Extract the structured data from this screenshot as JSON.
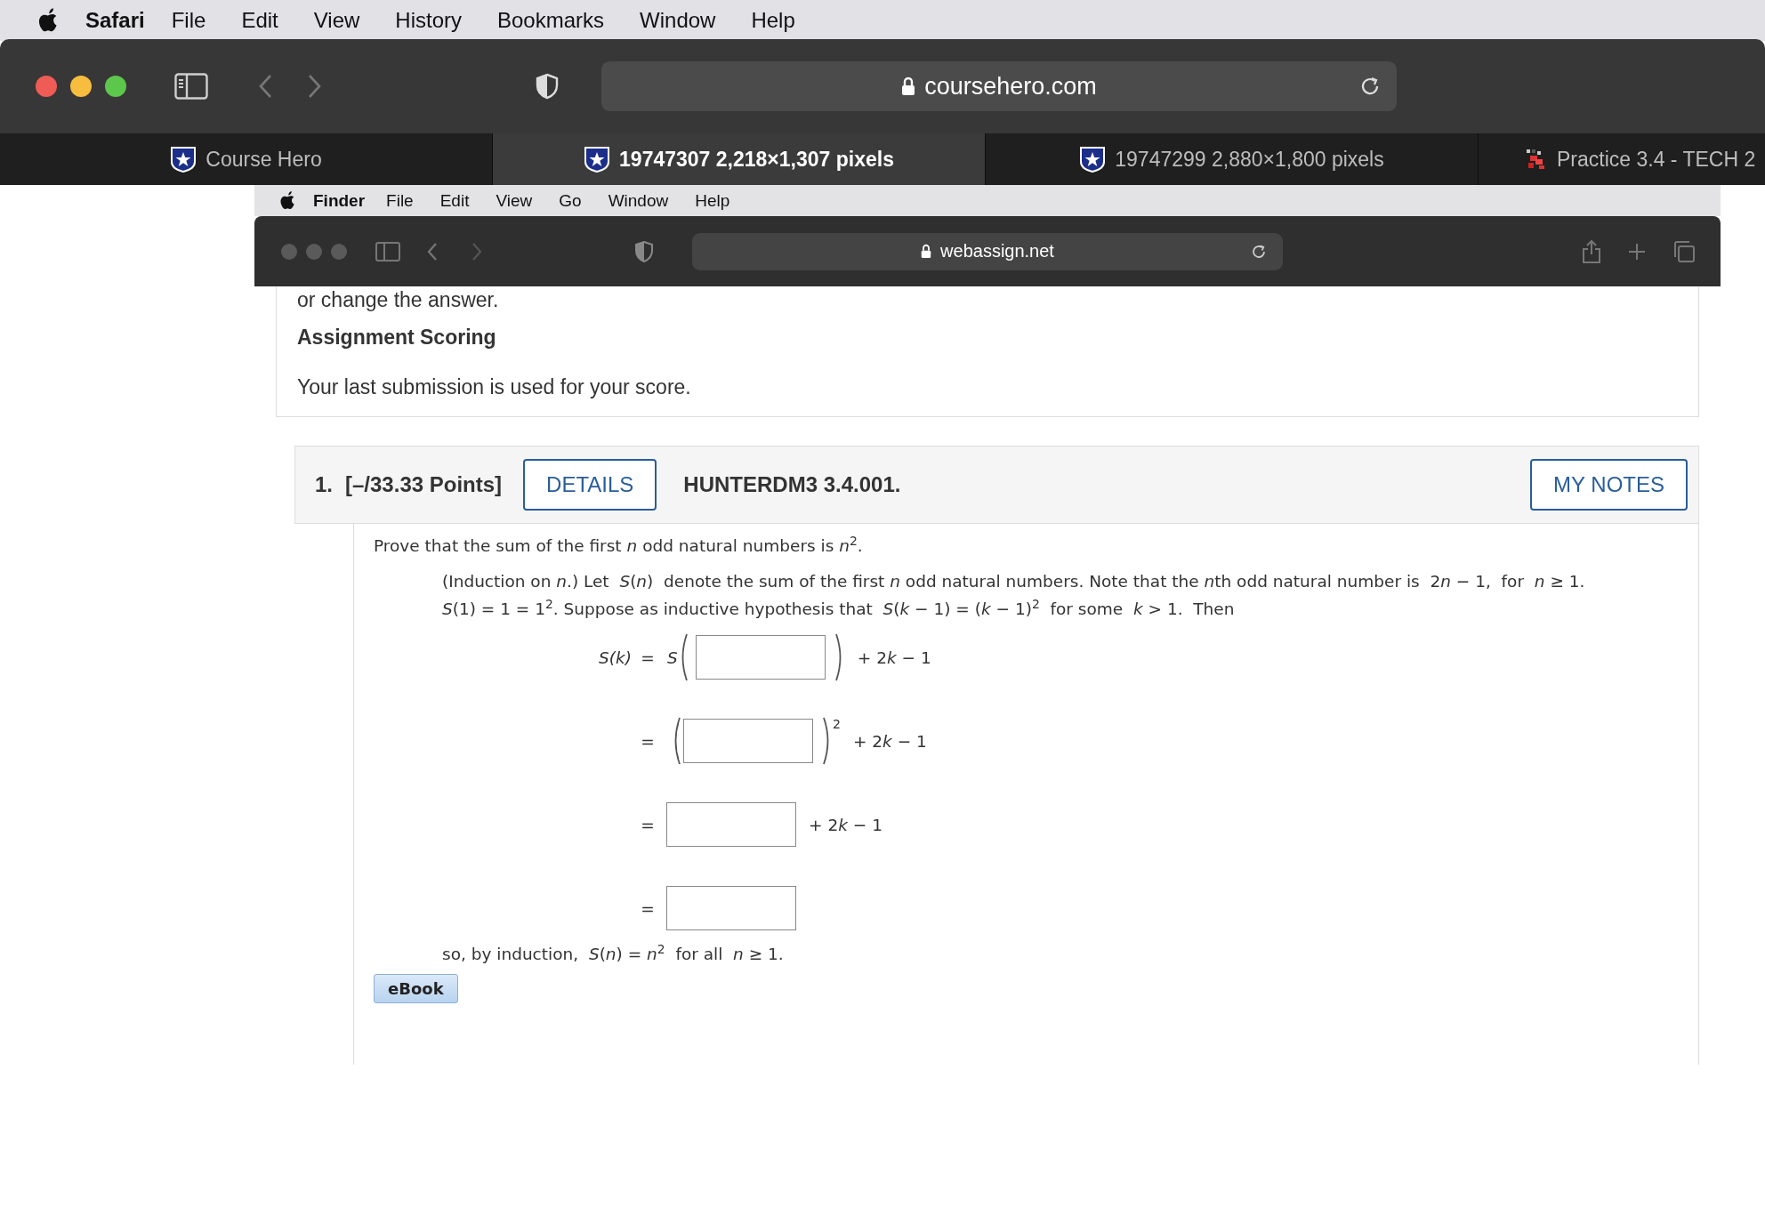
{
  "menu_bar": {
    "app": "Safari",
    "items": [
      "File",
      "Edit",
      "View",
      "History",
      "Bookmarks",
      "Window",
      "Help"
    ]
  },
  "browser": {
    "address": "coursehero.com",
    "tabs": [
      {
        "label": "Course Hero",
        "kind": "shield",
        "selected": false
      },
      {
        "label": "19747307 2,218×1,307 pixels",
        "kind": "shield",
        "selected": true
      },
      {
        "label": "19747299 2,880×1,800 pixels",
        "kind": "shield",
        "selected": false
      },
      {
        "label": "Practice 3.4 - TECH 2",
        "kind": "sprite",
        "selected": false
      }
    ]
  },
  "inner_window": {
    "menu_bar": {
      "app": "Finder",
      "items": [
        "File",
        "Edit",
        "View",
        "Go",
        "Window",
        "Help"
      ]
    },
    "address": "webassign.net"
  },
  "page": {
    "cut_text": "or change the answer.",
    "scoring_heading": "Assignment Scoring",
    "scoring_text": "Your last submission is used for your score."
  },
  "question": {
    "number": "1.",
    "points": "[–/33.33 Points]",
    "details_button": "DETAILS",
    "code": "HUNTERDM3 3.4.001.",
    "notes_button": "MY NOTES",
    "prompt": "Prove that the sum of the first *n* odd natural numbers is *n*$^{2}$.",
    "hint_lines": [
      [
        {
          "text": "(Induction on ",
          "italic": false
        },
        {
          "text": "n",
          "italic": true
        },
        {
          "text": ".) Let  ",
          "italic": false
        },
        {
          "text": "S",
          "italic": true
        },
        {
          "text": "(",
          "italic": false
        },
        {
          "text": "n",
          "italic": true
        },
        {
          "text": ")  denote the sum of the first ",
          "italic": false
        },
        {
          "text": "n",
          "italic": true
        },
        {
          "text": " odd natural numbers. Note that the ",
          "italic": false
        },
        {
          "text": "n",
          "italic": true
        },
        {
          "text": "th odd natural number is  2",
          "italic": false
        },
        {
          "text": "n",
          "italic": true
        },
        {
          "text": " − 1,  for  ",
          "italic": false
        },
        {
          "text": "n",
          "italic": true
        },
        {
          "text": " ≥ 1.",
          "italic": false
        }
      ],
      [
        {
          "text": "S",
          "italic": true
        },
        {
          "text": "(1) = 1 = 1",
          "italic": false
        },
        {
          "text": "2",
          "italic": false,
          "raised": true
        },
        {
          "text": ". Suppose as inductive hypothesis that  ",
          "italic": false
        },
        {
          "text": "S",
          "italic": true
        },
        {
          "text": "(",
          "italic": false
        },
        {
          "text": "k",
          "italic": true
        },
        {
          "text": " − 1) = (",
          "italic": false
        },
        {
          "text": "k",
          "italic": true
        },
        {
          "text": " − 1)",
          "italic": false
        },
        {
          "text": "2",
          "italic": false,
          "raised": true
        },
        {
          "text": "  for some  ",
          "italic": false
        },
        {
          "text": "k",
          "italic": true
        },
        {
          "text": " > 1.  Then",
          "italic": false
        }
      ]
    ],
    "steps": [
      {
        "kind": "call",
        "lhs": "*S*(*k*)",
        "eq": "=",
        "func": "S",
        "suffix": [
          {
            "text": "+ 2",
            "italic": false
          },
          {
            "text": "k",
            "italic": true
          },
          {
            "text": " − 1",
            "italic": false
          }
        ]
      },
      {
        "kind": "power",
        "eq": "=",
        "exponent": "2",
        "suffix": [
          {
            "text": "+ 2",
            "italic": false
          },
          {
            "text": "k",
            "italic": true
          },
          {
            "text": " − 1",
            "italic": false
          }
        ]
      },
      {
        "kind": "plain",
        "eq": "=",
        "suffix": [
          {
            "text": "+ 2",
            "italic": false
          },
          {
            "text": "k",
            "italic": true
          },
          {
            "text": " − 1",
            "italic": false
          }
        ]
      },
      {
        "kind": "plain",
        "eq": "="
      }
    ],
    "conclusion": "so, by induction,  *S*(*n*) = *n*$^{2}$  for all  *n* ≥ 1.",
    "ebook_button": "eBook"
  }
}
